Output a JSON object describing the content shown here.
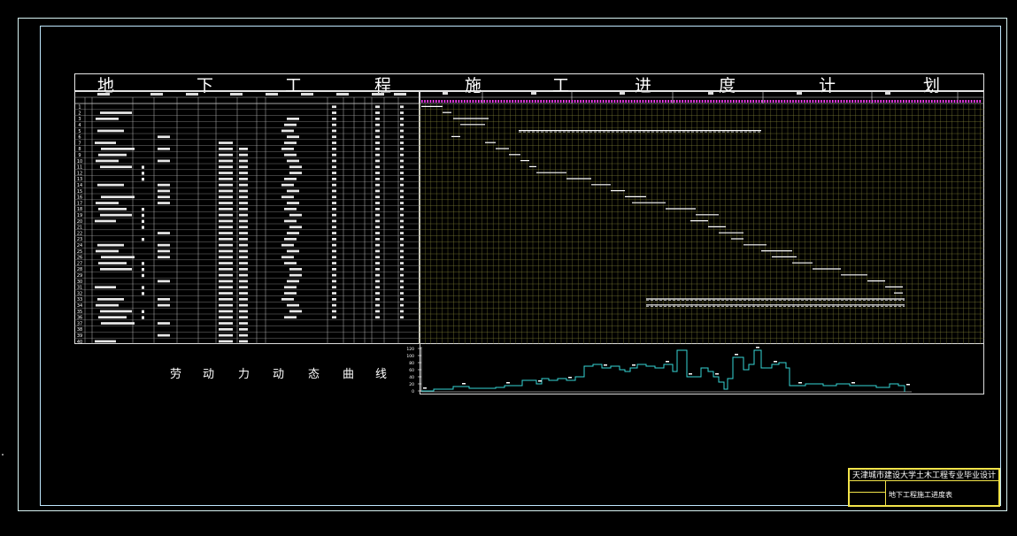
{
  "drawing": {
    "title_chars": [
      "地",
      "下",
      "工",
      "程",
      "施",
      "工",
      "进",
      "度",
      "计",
      "划"
    ],
    "curve_label_chars": [
      "劳",
      "动",
      "力",
      "动",
      "态",
      "曲",
      "线"
    ],
    "titleblock": {
      "school": "天津城市建设大学土木工程专业毕业设计",
      "drawing_name": "地下工程施工进度表"
    }
  },
  "colors": {
    "grid": "#c8c8c8",
    "gantt_grid": "#8a8a3a",
    "gantt_bar": "#ffffff",
    "curve": "#36d6d6",
    "magenta_ticks": "#ff40ff",
    "titleblock_border": "#f2e44a"
  },
  "table": {
    "row_numbers": [
      "1",
      "2",
      "3",
      "4",
      "5",
      "6",
      "7",
      "8",
      "9",
      "10",
      "11",
      "12",
      "13",
      "14",
      "15",
      "16",
      "17",
      "18",
      "19",
      "20",
      "21",
      "22",
      "23",
      "24",
      "25",
      "26",
      "27",
      "28",
      "29",
      "30",
      "31",
      "32",
      "33",
      "34",
      "35",
      "36",
      "37",
      "38",
      "39",
      "40"
    ]
  },
  "curve": {
    "y_ticks": [
      "120",
      "100",
      "80",
      "60",
      "40",
      "20",
      "0"
    ]
  }
}
